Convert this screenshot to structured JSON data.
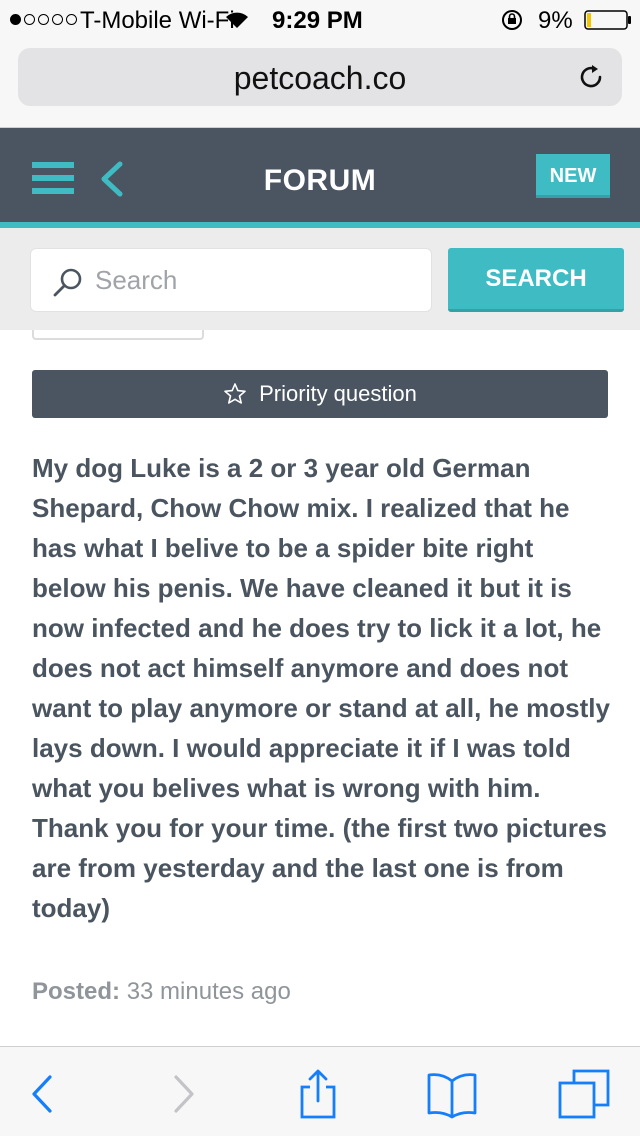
{
  "status_bar": {
    "carrier": "T-Mobile Wi-Fi",
    "time": "9:29 PM",
    "battery": "9%",
    "signal_bars_filled": 1,
    "signal_bars_total": 5
  },
  "browser": {
    "url": "petcoach.co"
  },
  "header": {
    "title": "FORUM",
    "new_label": "NEW"
  },
  "search": {
    "placeholder": "Search",
    "button_label": "SEARCH"
  },
  "question": {
    "priority_label": "Priority question",
    "body": "My dog Luke is a 2 or 3 year old German Shepard, Chow Chow mix. I realized that he has what I belive to be a spider bite right below his penis. We have cleaned it but it is now infected and he does try to lick it a lot, he does not act himself anymore and does not want to play anymore or stand at all, he mostly lays down. I would appreciate it if I was told what you belives what is wrong with him. Thank you for your time. (the first two pictures are from yesterday and the last one is from today)",
    "posted_label": "Posted:",
    "posted_time": "33 minutes ago"
  },
  "colors": {
    "header_bg": "#4a5561",
    "accent": "#3fbcc3",
    "text": "#4a5560",
    "ios_blue": "#147efb"
  },
  "icons": [
    "wifi-icon",
    "lock-rotation-icon",
    "battery-icon",
    "reload-icon",
    "menu-icon",
    "back-chevron-icon",
    "search-icon",
    "star-icon",
    "back-arrow-icon",
    "forward-arrow-icon",
    "share-icon",
    "bookmarks-icon",
    "tabs-icon"
  ]
}
